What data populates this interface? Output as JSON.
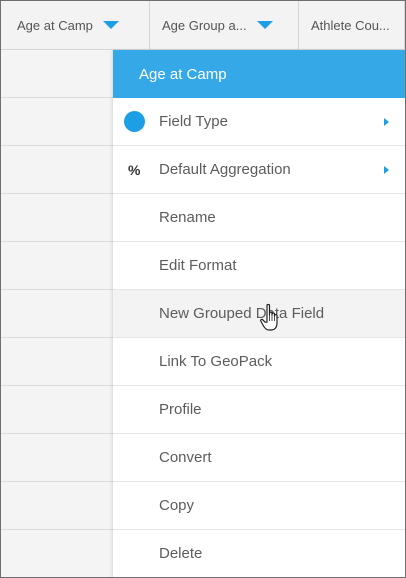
{
  "header": {
    "columns": [
      {
        "label": "Age at Camp"
      },
      {
        "label": "Age Group a..."
      },
      {
        "label": "Athlete Cou..."
      }
    ]
  },
  "menu": {
    "title": "Age at Camp",
    "items": [
      {
        "label": "Field Type",
        "icon": "dot-icon",
        "submenu": true
      },
      {
        "label": "Default Aggregation",
        "icon": "percent-icon",
        "icon_text": "%",
        "submenu": true
      },
      {
        "label": "Rename"
      },
      {
        "label": "Edit Format"
      },
      {
        "label": "New Grouped Data Field",
        "hovered": true
      },
      {
        "label": "Link To GeoPack"
      },
      {
        "label": "Profile"
      },
      {
        "label": "Convert"
      },
      {
        "label": "Copy"
      },
      {
        "label": "Delete"
      }
    ]
  },
  "colors": {
    "accent": "#35a8e7",
    "icon_blue": "#1d9fe5"
  }
}
